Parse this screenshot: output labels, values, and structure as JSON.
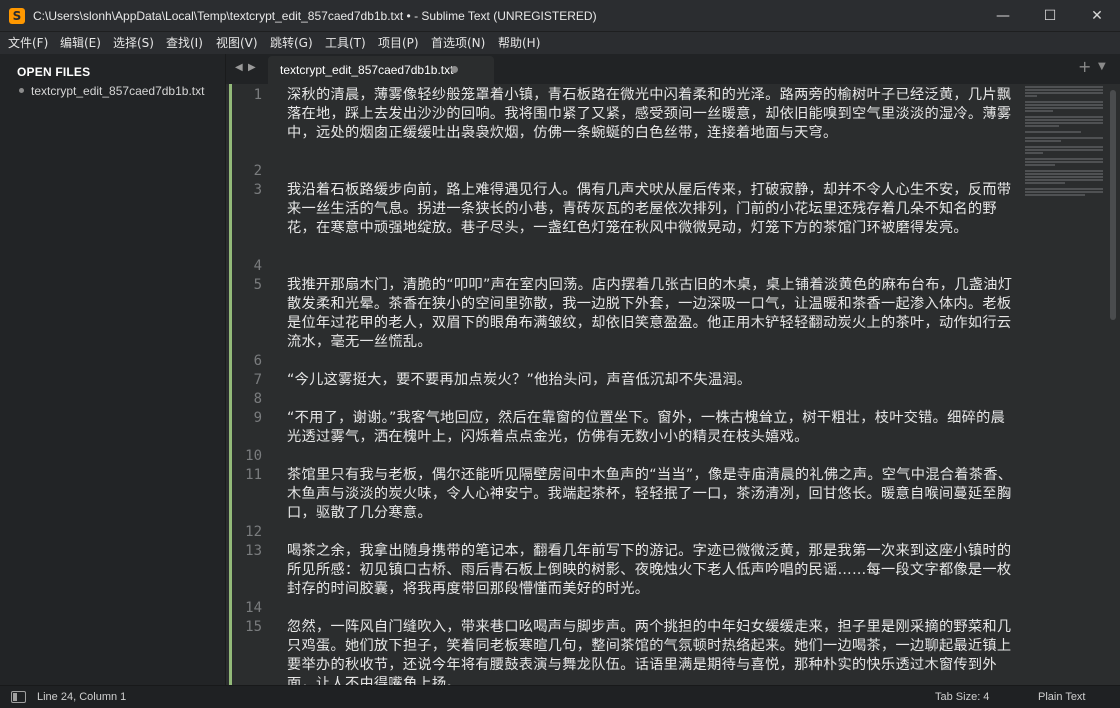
{
  "window": {
    "title": "C:\\Users\\slonh\\AppData\\Local\\Temp\\textcrypt_edit_857caed7db1b.txt • - Sublime Text (UNREGISTERED)",
    "icon_label": "S",
    "minimize_label": "—",
    "maximize_label": "☐",
    "close_label": "✕"
  },
  "menu": [
    "文件(F)",
    "编辑(E)",
    "选择(S)",
    "查找(I)",
    "视图(V)",
    "跳转(G)",
    "工具(T)",
    "项目(P)",
    "首选项(N)",
    "帮助(H)"
  ],
  "sidebar": {
    "header": "OPEN FILES",
    "files": [
      "textcrypt_edit_857caed7db1b.txt"
    ]
  },
  "tabs": {
    "left_arrow": "◀",
    "right_arrow": "▶",
    "active": "textcrypt_edit_857caed7db1b.txt",
    "plus_label": "+",
    "menu_label": "▼"
  },
  "editor": {
    "lines": [
      {
        "n": "1",
        "text": "深秋的清晨，薄雾像轻纱般笼罩着小镇，青石板路在微光中闪着柔和的光泽。路两旁的榆树叶子已经泛黄，几片飘落在地，踩上去发出沙沙的回响。我将围巾紧了又紧，感受颈间一丝暖意，却依旧能嗅到空气里淡淡的湿冷。薄雾中，远处的烟囱正缓缓吐出袅袅炊烟，仿佛一条蜿蜒的白色丝带，连接着地面与天穹。"
      },
      {
        "n": "2",
        "text": ""
      },
      {
        "n": "3",
        "text": "我沿着石板路缓步向前，路上难得遇见行人。偶有几声犬吠从屋后传来，打破寂静，却并不令人心生不安，反而带来一丝生活的气息。拐进一条狭长的小巷，青砖灰瓦的老屋依次排列，门前的小花坛里还残存着几朵不知名的野花，在寒意中顽强地绽放。巷子尽头，一盏红色灯笼在秋风中微微晃动，灯笼下方的茶馆门环被磨得发亮。"
      },
      {
        "n": "4",
        "text": ""
      },
      {
        "n": "5",
        "text": "我推开那扇木门，清脆的“叩叩”声在室内回荡。店内摆着几张古旧的木桌，桌上铺着淡黄色的麻布台布，几盏油灯散发柔和光晕。茶香在狭小的空间里弥散，我一边脱下外套，一边深吸一口气，让温暖和茶香一起渗入体内。老板是位年过花甲的老人，双眉下的眼角布满皱纹，却依旧笑意盈盈。他正用木铲轻轻翻动炭火上的茶叶，动作如行云流水，毫无一丝慌乱。"
      },
      {
        "n": "6",
        "text": ""
      },
      {
        "n": "7",
        "text": "“今儿这雾挺大，要不要再加点炭火？”他抬头问，声音低沉却不失温润。"
      },
      {
        "n": "8",
        "text": ""
      },
      {
        "n": "9",
        "text": "“不用了，谢谢。”我客气地回应，然后在靠窗的位置坐下。窗外，一株古槐耸立，树干粗壮，枝叶交错。细碎的晨光透过雾气，洒在槐叶上，闪烁着点点金光，仿佛有无数小小的精灵在枝头嬉戏。"
      },
      {
        "n": "10",
        "text": ""
      },
      {
        "n": "11",
        "text": "茶馆里只有我与老板，偶尔还能听见隔壁房间中木鱼声的“当当”，像是寺庙清晨的礼佛之声。空气中混合着茶香、木鱼声与淡淡的炭火味，令人心神安宁。我端起茶杯，轻轻抿了一口，茶汤清冽，回甘悠长。暖意自喉间蔓延至胸口，驱散了几分寒意。"
      },
      {
        "n": "12",
        "text": ""
      },
      {
        "n": "13",
        "text": "喝茶之余，我拿出随身携带的笔记本，翻看几年前写下的游记。字迹已微微泛黄，那是我第一次来到这座小镇时的所见所感：初见镇口古桥、雨后青石板上倒映的树影、夜晚烛火下老人低声吟唱的民谣……每一段文字都像是一枚封存的时间胶囊，将我再度带回那段懵懂而美好的时光。"
      },
      {
        "n": "14",
        "text": ""
      },
      {
        "n": "15",
        "text": "忽然，一阵风自门缝吹入，带来巷口吆喝声与脚步声。两个挑担的中年妇女缓缓走来，担子里是刚采摘的野菜和几只鸡蛋。她们放下担子，笑着同老板寒暄几句，整间茶馆的气氛顿时热络起来。她们一边喝茶，一边聊起最近镇上要举办的秋收节，还说今年将有腰鼓表演与舞龙队伍。话语里满是期待与喜悦，那种朴实的快乐透过木窗传到外面，让人不由得嘴角上扬。"
      }
    ]
  },
  "status": {
    "position": "Line 24, Column 1",
    "tab_size": "Tab Size: 4",
    "syntax": "Plain Text"
  }
}
